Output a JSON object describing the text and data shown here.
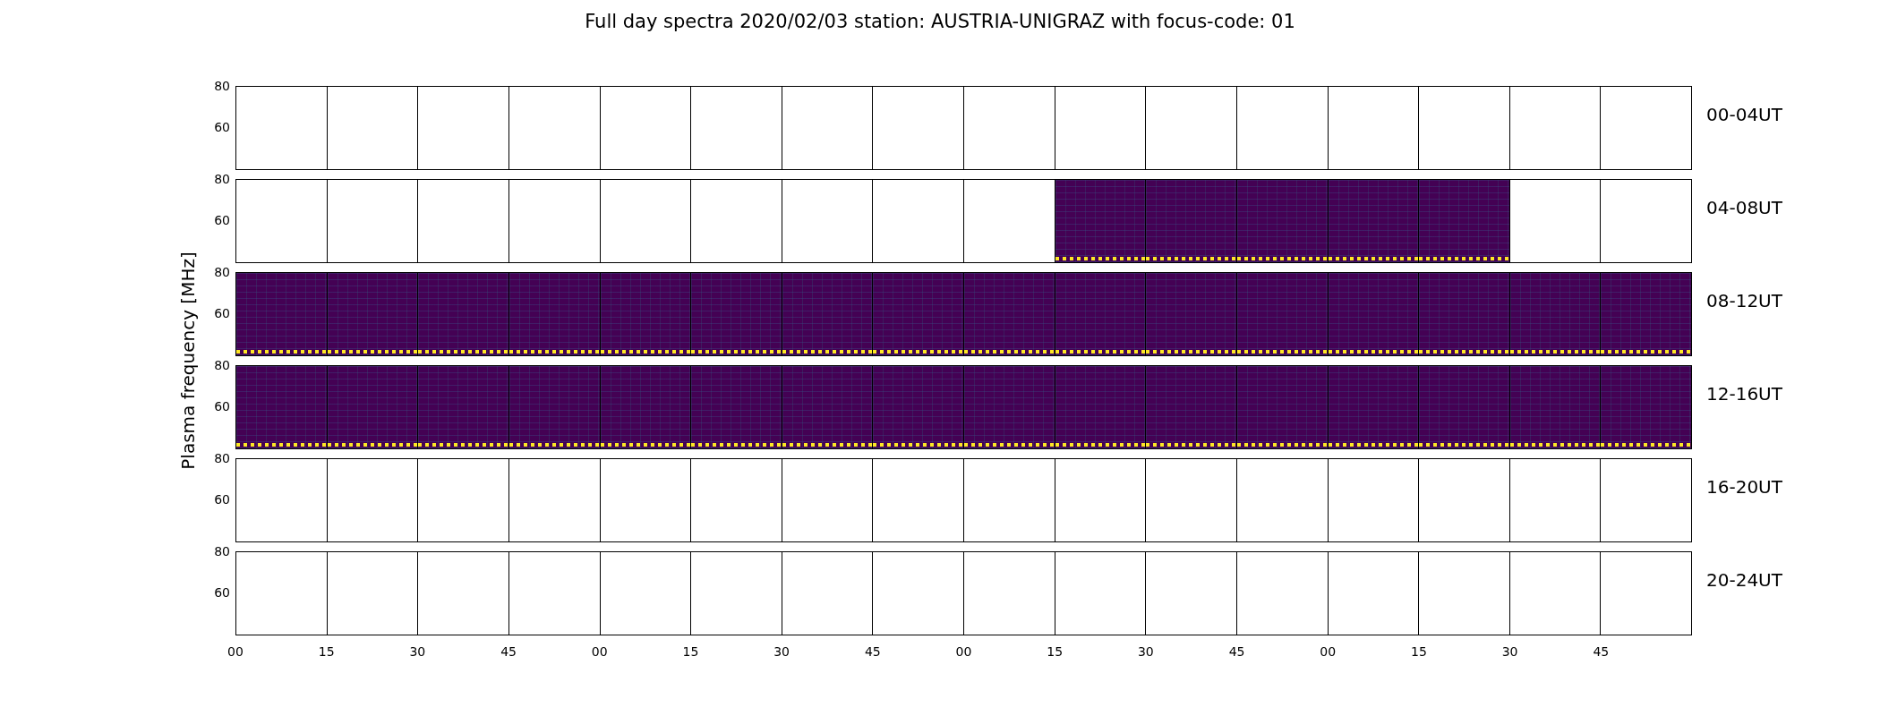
{
  "title": "Full day spectra 2020/02/03 station: AUSTRIA-UNIGRAZ with focus-code: 01",
  "ylabel": "Plasma frequency [MHz]",
  "rows": [
    {
      "label": "00-04UT",
      "yticks": [
        "80",
        "60"
      ],
      "panels": [
        {
          "has_data": false
        },
        {
          "has_data": false
        },
        {
          "has_data": false
        },
        {
          "has_data": false
        },
        {
          "has_data": false
        },
        {
          "has_data": false
        },
        {
          "has_data": false
        },
        {
          "has_data": false
        },
        {
          "has_data": false
        },
        {
          "has_data": false
        },
        {
          "has_data": false
        },
        {
          "has_data": false
        },
        {
          "has_data": false
        },
        {
          "has_data": false
        },
        {
          "has_data": false
        },
        {
          "has_data": false
        }
      ]
    },
    {
      "label": "04-08UT",
      "yticks": [
        "80",
        "60"
      ],
      "panels": [
        {
          "has_data": false
        },
        {
          "has_data": false
        },
        {
          "has_data": false
        },
        {
          "has_data": false
        },
        {
          "has_data": false
        },
        {
          "has_data": false
        },
        {
          "has_data": false
        },
        {
          "has_data": false
        },
        {
          "has_data": false
        },
        {
          "has_data": true
        },
        {
          "has_data": true
        },
        {
          "has_data": true
        },
        {
          "has_data": true
        },
        {
          "has_data": true
        },
        {
          "has_data": false
        },
        {
          "has_data": false
        }
      ]
    },
    {
      "label": "08-12UT",
      "yticks": [
        "80",
        "60"
      ],
      "panels": [
        {
          "has_data": true
        },
        {
          "has_data": true
        },
        {
          "has_data": true
        },
        {
          "has_data": true
        },
        {
          "has_data": true
        },
        {
          "has_data": true
        },
        {
          "has_data": true
        },
        {
          "has_data": true
        },
        {
          "has_data": true
        },
        {
          "has_data": true
        },
        {
          "has_data": true
        },
        {
          "has_data": true
        },
        {
          "has_data": true
        },
        {
          "has_data": true
        },
        {
          "has_data": true
        },
        {
          "has_data": true
        }
      ]
    },
    {
      "label": "12-16UT",
      "yticks": [
        "80",
        "60"
      ],
      "panels": [
        {
          "has_data": true
        },
        {
          "has_data": true
        },
        {
          "has_data": true
        },
        {
          "has_data": true
        },
        {
          "has_data": true
        },
        {
          "has_data": true
        },
        {
          "has_data": true
        },
        {
          "has_data": true
        },
        {
          "has_data": true
        },
        {
          "has_data": true
        },
        {
          "has_data": true
        },
        {
          "has_data": true
        },
        {
          "has_data": true
        },
        {
          "has_data": true
        },
        {
          "has_data": true
        },
        {
          "has_data": true
        }
      ]
    },
    {
      "label": "16-20UT",
      "yticks": [
        "80",
        "60"
      ],
      "panels": [
        {
          "has_data": false
        },
        {
          "has_data": false
        },
        {
          "has_data": false
        },
        {
          "has_data": false
        },
        {
          "has_data": false
        },
        {
          "has_data": false
        },
        {
          "has_data": false
        },
        {
          "has_data": false
        },
        {
          "has_data": false
        },
        {
          "has_data": false
        },
        {
          "has_data": false
        },
        {
          "has_data": false
        },
        {
          "has_data": false
        },
        {
          "has_data": false
        },
        {
          "has_data": false
        },
        {
          "has_data": false
        }
      ]
    },
    {
      "label": "20-24UT",
      "yticks": [
        "80",
        "60"
      ],
      "panels": [
        {
          "has_data": false
        },
        {
          "has_data": false
        },
        {
          "has_data": false
        },
        {
          "has_data": false
        },
        {
          "has_data": false
        },
        {
          "has_data": false
        },
        {
          "has_data": false
        },
        {
          "has_data": false
        },
        {
          "has_data": false
        },
        {
          "has_data": false
        },
        {
          "has_data": false
        },
        {
          "has_data": false
        },
        {
          "has_data": false
        },
        {
          "has_data": false
        },
        {
          "has_data": false
        },
        {
          "has_data": false
        }
      ]
    }
  ],
  "xticks": [
    "00",
    "15",
    "30",
    "45",
    "00",
    "15",
    "30",
    "45",
    "00",
    "15",
    "30",
    "45",
    "00",
    "15",
    "30",
    "45"
  ]
}
